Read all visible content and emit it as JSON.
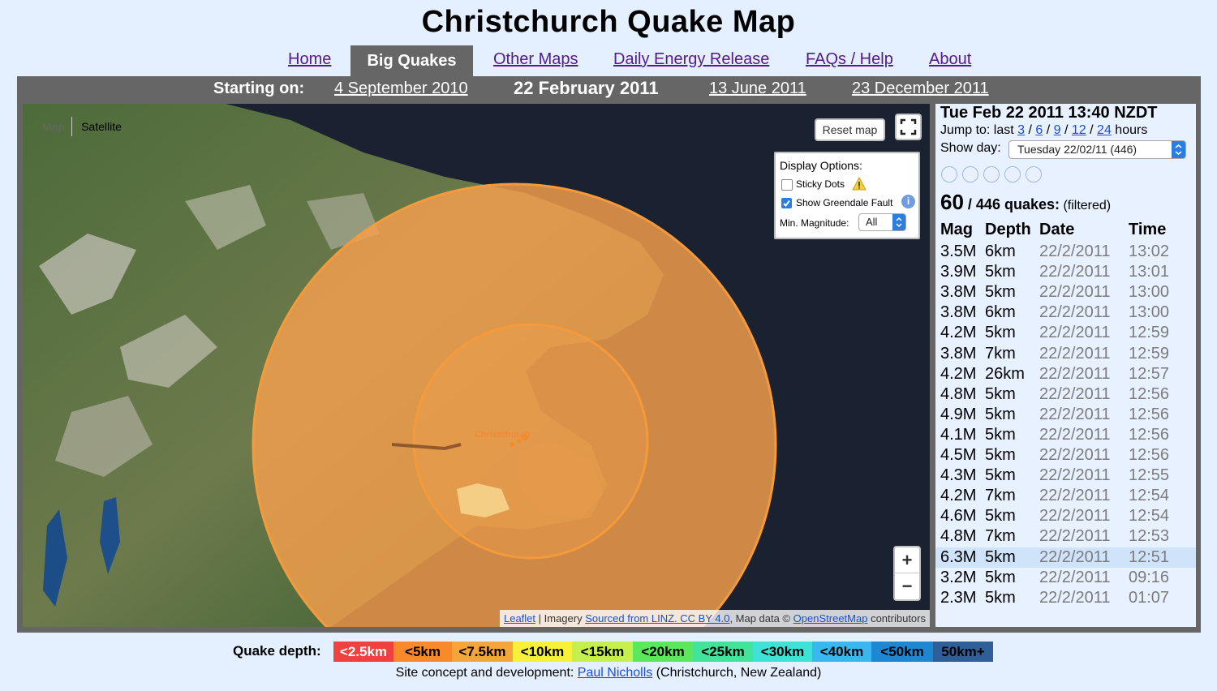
{
  "title": "Christchurch Quake Map",
  "nav": {
    "home": "Home",
    "big_quakes": "Big Quakes",
    "other_maps": "Other Maps",
    "daily_energy": "Daily Energy Release",
    "faqs": "FAQs / Help",
    "about": "About"
  },
  "dates": {
    "label": "Starting on:",
    "d1": "4 September 2010",
    "current": "22 February 2011",
    "d3": "13 June 2011",
    "d4": "23 December 2011"
  },
  "map": {
    "map_btn": "Map",
    "satellite_btn": "Satellite",
    "reset_btn": "Reset map",
    "place_label": "Christchurch",
    "zoom_in": "+",
    "zoom_out": "−",
    "display_options": {
      "title": "Display Options:",
      "sticky_dots": "Sticky Dots",
      "show_fault": "Show Greendale Fault",
      "min_mag_label": "Min. Magnitude:",
      "min_mag_value": "All"
    },
    "attribution": {
      "leaflet": "Leaflet",
      "imagery": " | Imagery ",
      "linz": "Sourced from LINZ. CC BY 4.0",
      "mapdata": ", Map data © ",
      "osm": "OpenStreetMap",
      "contrib": " contributors"
    }
  },
  "panel": {
    "heading": "Tue Feb 22 2011 13:40 NZDT",
    "jump_label": "Jump to: last ",
    "jump_links": [
      "3",
      "6",
      "9",
      "12",
      "24"
    ],
    "jump_suffix": " hours",
    "show_day_label": "Show day:",
    "show_day_value": "Tuesday 22/02/11 (446)",
    "count_shown": "60",
    "count_total": " / 446 quakes:",
    "filtered": " (filtered)",
    "headers": [
      "Mag",
      "Depth",
      "Date",
      "Time"
    ],
    "rows": [
      [
        "3.5M",
        "6km",
        "22/2/2011",
        "13:02"
      ],
      [
        "3.9M",
        "5km",
        "22/2/2011",
        "13:01"
      ],
      [
        "3.8M",
        "5km",
        "22/2/2011",
        "13:00"
      ],
      [
        "3.8M",
        "6km",
        "22/2/2011",
        "13:00"
      ],
      [
        "4.2M",
        "5km",
        "22/2/2011",
        "12:59"
      ],
      [
        "3.8M",
        "7km",
        "22/2/2011",
        "12:59"
      ],
      [
        "4.2M",
        "26km",
        "22/2/2011",
        "12:57"
      ],
      [
        "4.8M",
        "5km",
        "22/2/2011",
        "12:56"
      ],
      [
        "4.9M",
        "5km",
        "22/2/2011",
        "12:56"
      ],
      [
        "4.1M",
        "5km",
        "22/2/2011",
        "12:56"
      ],
      [
        "4.5M",
        "5km",
        "22/2/2011",
        "12:56"
      ],
      [
        "4.3M",
        "5km",
        "22/2/2011",
        "12:55"
      ],
      [
        "4.2M",
        "7km",
        "22/2/2011",
        "12:54"
      ],
      [
        "4.6M",
        "5km",
        "22/2/2011",
        "12:54"
      ],
      [
        "4.8M",
        "7km",
        "22/2/2011",
        "12:53"
      ],
      [
        "6.3M",
        "5km",
        "22/2/2011",
        "12:51"
      ],
      [
        "3.2M",
        "5km",
        "22/2/2011",
        "09:16"
      ],
      [
        "2.3M",
        "5km",
        "22/2/2011",
        "01:07"
      ]
    ],
    "highlighted_row_index": 15
  },
  "legend": {
    "label": "Quake depth:",
    "items": [
      {
        "text": "<2.5km",
        "color": "#f0413f",
        "fg": "#ffffff"
      },
      {
        "text": "<5km",
        "color": "#f88a2b",
        "fg": "#000000"
      },
      {
        "text": "<7.5km",
        "color": "#f5a63a",
        "fg": "#000000"
      },
      {
        "text": "<10km",
        "color": "#f8f13a",
        "fg": "#000000"
      },
      {
        "text": "<15km",
        "color": "#c5f04d",
        "fg": "#000000"
      },
      {
        "text": "<20km",
        "color": "#5be85d",
        "fg": "#000000"
      },
      {
        "text": "<25km",
        "color": "#42e39b",
        "fg": "#000000"
      },
      {
        "text": "<30km",
        "color": "#3fe2d7",
        "fg": "#000000"
      },
      {
        "text": "<40km",
        "color": "#39b8f0",
        "fg": "#000000"
      },
      {
        "text": "<50km",
        "color": "#1e87d2",
        "fg": "#000000"
      },
      {
        "text": "50km+",
        "color": "#2f5f98",
        "fg": "#000000"
      }
    ]
  },
  "footer": {
    "prefix": "Site concept and development: ",
    "author": "Paul Nicholls",
    "suffix": " (Christchurch, New Zealand)"
  },
  "colors": {
    "bg": "#e4efff",
    "frame": "#666666",
    "quake_fill": "#f6a04d",
    "link": "#1a4fd6"
  }
}
